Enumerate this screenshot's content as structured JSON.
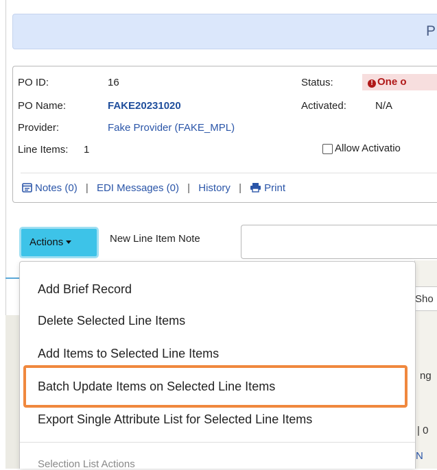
{
  "header": {
    "title_fragment": "P"
  },
  "po": {
    "id_label": "PO ID:",
    "id_value": "16",
    "name_label": "PO Name:",
    "name_value": "FAKE20231020",
    "provider_label": "Provider:",
    "provider_value": "Fake Provider (FAKE_MPL)",
    "line_items_label": "Line Items:",
    "line_items_value": "1",
    "status_label": "Status:",
    "status_value": "One o",
    "activated_label": "Activated:",
    "activated_value": "N/A",
    "allow_activation_label": "Allow Activatio"
  },
  "links": {
    "notes": "Notes (0)",
    "edi": "EDI Messages (0)",
    "history": "History",
    "print": "Print",
    "separator": "|"
  },
  "toolbar": {
    "actions_label": "Actions",
    "note_label": "New Line Item Note"
  },
  "menu": {
    "items": [
      "Add Brief Record",
      "Delete Selected Line Items",
      "Add Items to Selected Line Items",
      "Batch Update Items on Selected Line Items",
      "Export Single Attribute List for Selected Line Items"
    ],
    "section_header": "Selection List Actions"
  },
  "background": {
    "show_fragment": "Sho",
    "ng_fragment": "ng",
    "zero_fragment": "| 0",
    "n_fragment": "N"
  },
  "colors": {
    "actions_button": "#3dc3e8",
    "highlight_border": "#f0883e",
    "link": "#2a55a8",
    "status_bg": "#f7dede"
  }
}
